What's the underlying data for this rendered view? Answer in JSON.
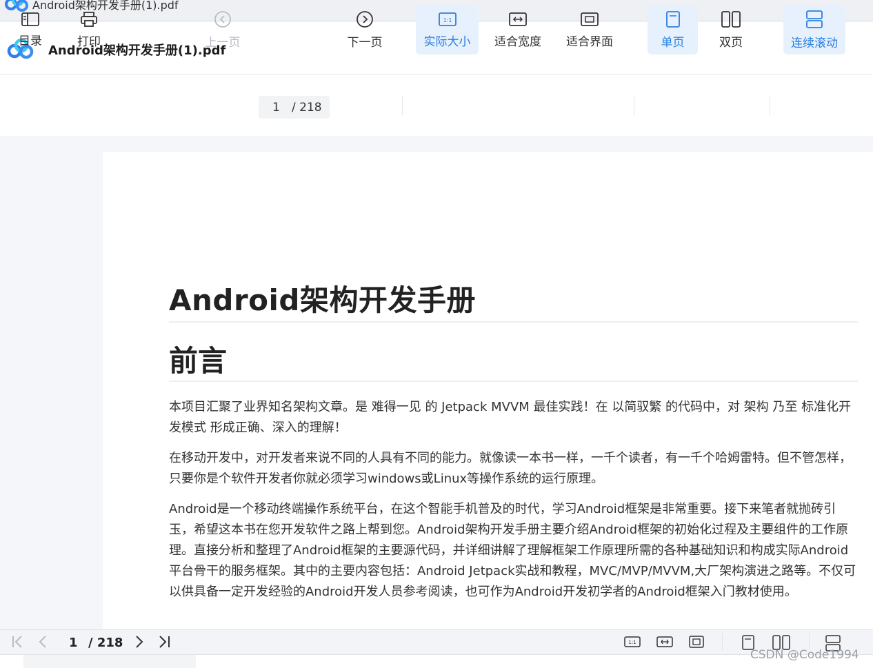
{
  "window": {
    "title": "Android架构开发手册(1).pdf"
  },
  "header": {
    "doc_title": "Android架构开发手册(1).pdf"
  },
  "toolbar": {
    "toc": "目录",
    "print": "打印",
    "prev": "上一页",
    "current_page": "1",
    "total_pages": "/ 218",
    "next": "下一页",
    "actual_size": "实际大小",
    "fit_width": "适合宽度",
    "fit_page": "适合界面",
    "single": "单页",
    "double": "双页",
    "continuous": "连续滚动",
    "accent": "#2a7de1"
  },
  "document": {
    "title": "Android架构开发手册",
    "subtitle": "前言",
    "paragraphs": [
      "本项目汇聚了业界知名架构文章。是 难得一见 的 Jetpack MVVM 最佳实践！在 以简驭繁 的代码中，对 架构 乃至 标准化开发模式 形成正确、深入的理解！",
      "在移动开发中，对开发者来说不同的人具有不同的能力。就像读一本书一样，一千个读者，有一千个哈姆雷特。但不管怎样，只要你是个软件开发者你就必须学习windows或Linux等操作系统的运行原理。",
      "Android是一个移动终端操作系统平台，在这个智能手机普及的时代，学习Android框架是非常重要。接下来笔者就抛砖引玉，希望这本书在您开发软件之路上帮到您。Android架构开发手册主要介绍Android框架的初始化过程及主要组件的工作原理。直接分析和整理了Android框架的主要源代码，并详细讲解了理解框架工作原理所需的各种基础知识和构成实际Android平台骨干的服务框架。其中的主要内容包括：Android Jetpack实战和教程，MVC/MVP/MVVM,大厂架构演进之路等。不仅可以供具备一定开发经验的Android开发人员参考阅读，也可作为Android开发初学者的Android框架入门教材使用。"
    ]
  },
  "bottombar": {
    "current_page": "1",
    "total_pages": "/ 218"
  },
  "watermark": "CSDN @Code1994"
}
